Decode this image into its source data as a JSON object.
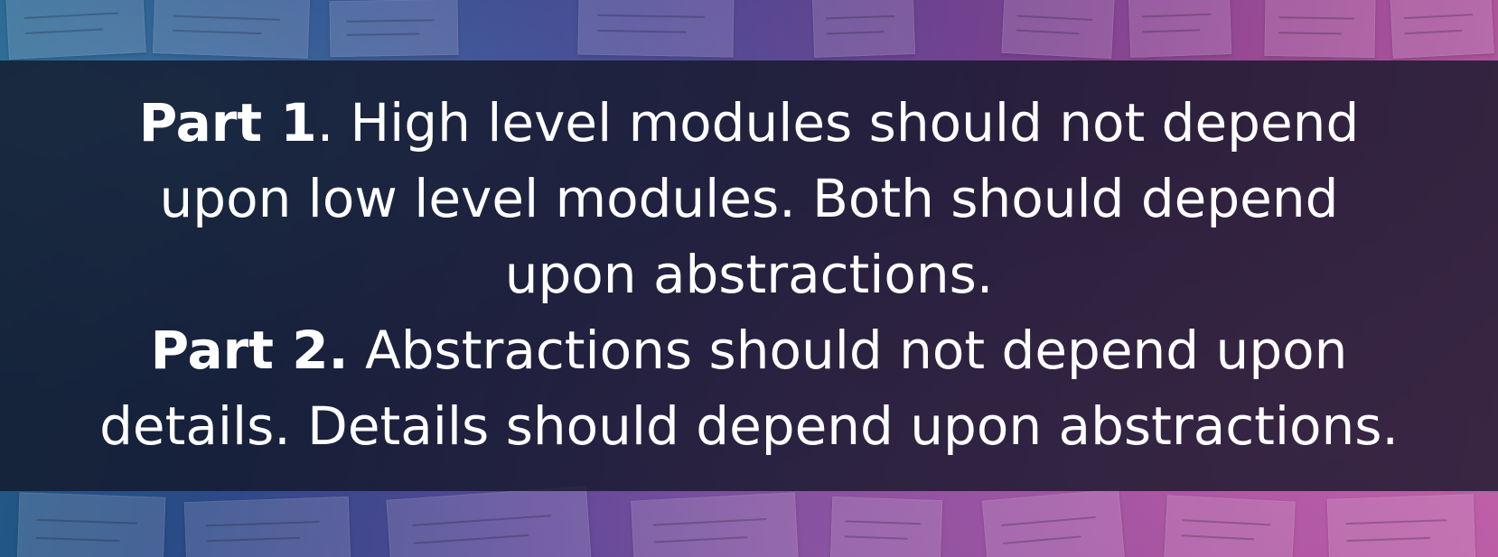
{
  "background": {
    "description_colors": [
      "#1e5d86",
      "#4a3f8e",
      "#9a4a94",
      "#b45aa0"
    ],
    "band_color": "#12162680"
  },
  "quote": {
    "part1_label": "Part 1",
    "part1_line1_rest": ". High level modules should not depend",
    "part1_line2": "upon low level modules. Both should depend",
    "part1_line3": "upon abstractions.",
    "part2_label": "Part 2.",
    "part2_line1_rest": " Abstractions should not depend upon",
    "part2_line2": "details. Details should depend upon abstractions."
  }
}
